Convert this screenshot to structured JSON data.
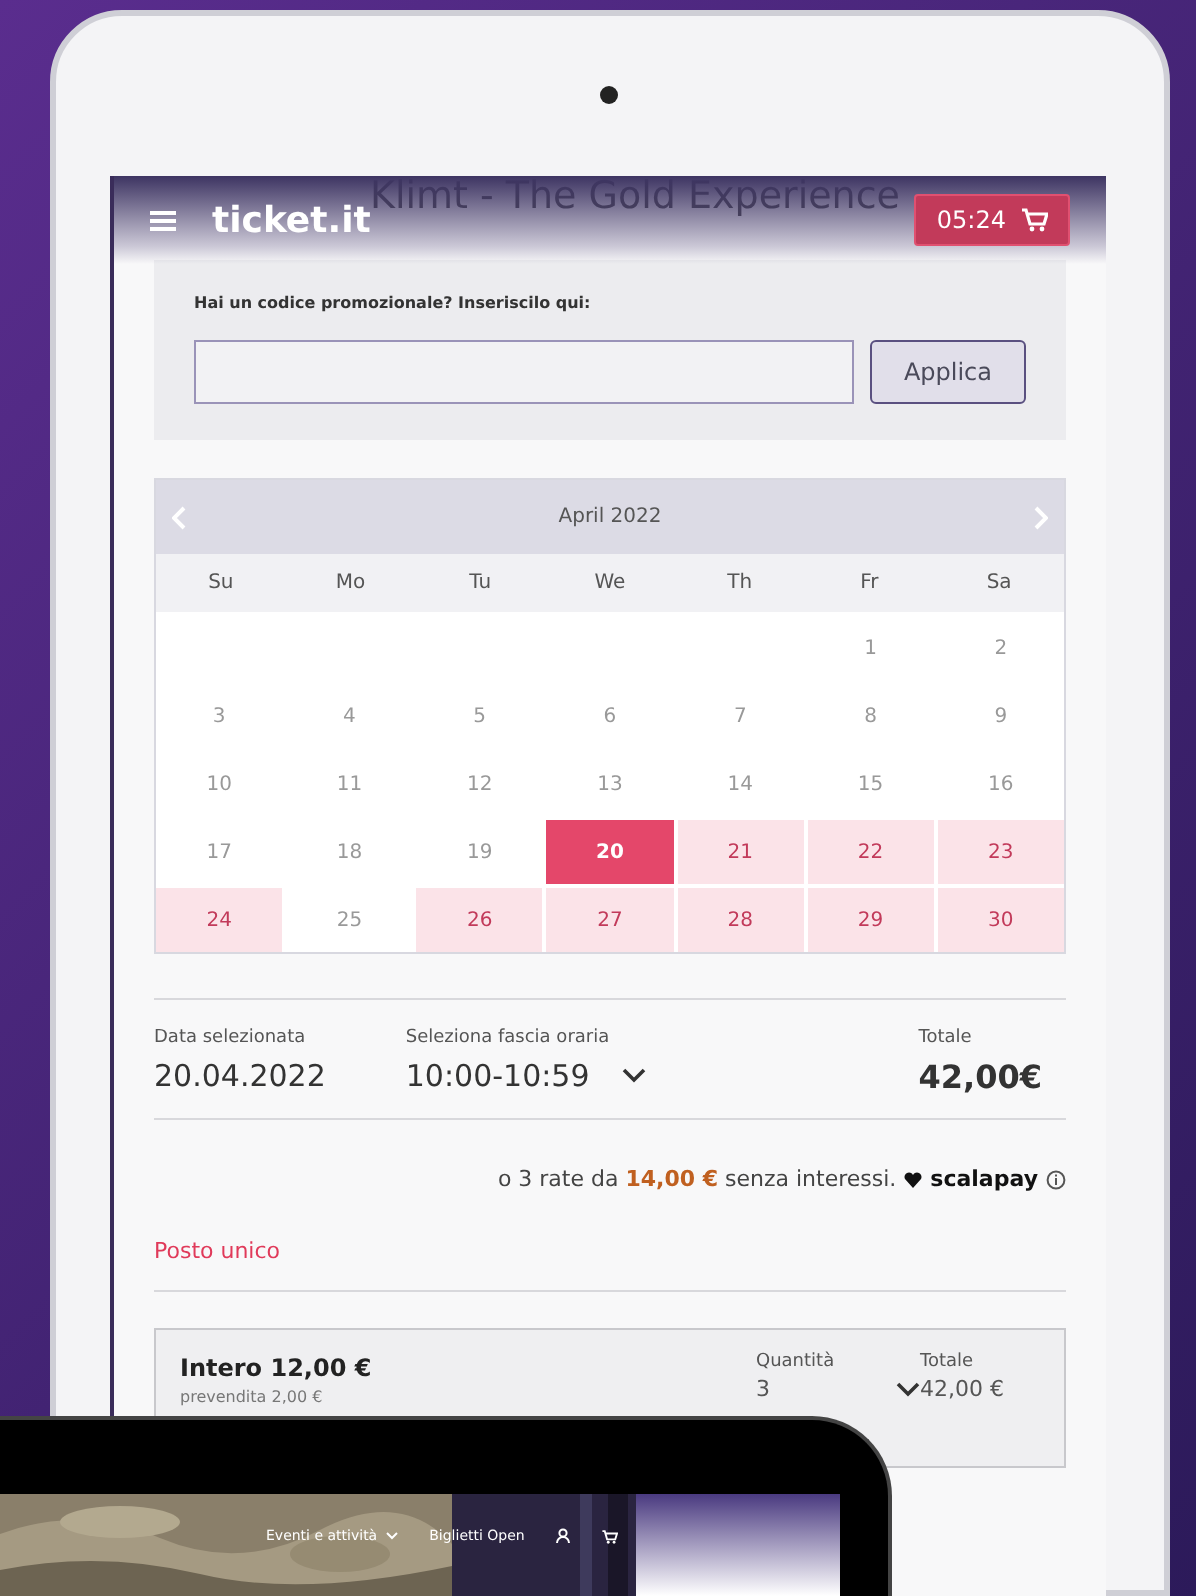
{
  "title": "Klimt - The Gold Experience",
  "header": {
    "logo": "ticket.it",
    "timer": "05:24"
  },
  "promo": {
    "label": "Hai un codice promozionale? Inseriscilo qui:",
    "button": "Applica"
  },
  "calendar": {
    "month": "April 2022",
    "weekdays": [
      "Su",
      "Mo",
      "Tu",
      "We",
      "Th",
      "Fr",
      "Sa"
    ],
    "weeks": [
      [
        {
          "kind": "blank"
        },
        {
          "kind": "blank"
        },
        {
          "kind": "blank"
        },
        {
          "kind": "blank"
        },
        {
          "kind": "blank"
        },
        {
          "kind": "day",
          "day": "1",
          "available": false,
          "selected": false
        },
        {
          "kind": "day",
          "day": "2",
          "available": false,
          "selected": false
        }
      ],
      [
        {
          "kind": "day",
          "day": "3",
          "available": false,
          "selected": false
        },
        {
          "kind": "day",
          "day": "4",
          "available": false,
          "selected": false
        },
        {
          "kind": "day",
          "day": "5",
          "available": false,
          "selected": false
        },
        {
          "kind": "day",
          "day": "6",
          "available": false,
          "selected": false
        },
        {
          "kind": "day",
          "day": "7",
          "available": false,
          "selected": false
        },
        {
          "kind": "day",
          "day": "8",
          "available": false,
          "selected": false
        },
        {
          "kind": "day",
          "day": "9",
          "available": false,
          "selected": false
        }
      ],
      [
        {
          "kind": "day",
          "day": "10",
          "available": false,
          "selected": false
        },
        {
          "kind": "day",
          "day": "11",
          "available": false,
          "selected": false
        },
        {
          "kind": "day",
          "day": "12",
          "available": false,
          "selected": false
        },
        {
          "kind": "day",
          "day": "13",
          "available": false,
          "selected": false
        },
        {
          "kind": "day",
          "day": "14",
          "available": false,
          "selected": false
        },
        {
          "kind": "day",
          "day": "15",
          "available": false,
          "selected": false
        },
        {
          "kind": "day",
          "day": "16",
          "available": false,
          "selected": false
        }
      ],
      [
        {
          "kind": "day",
          "day": "17",
          "available": false,
          "selected": false
        },
        {
          "kind": "day",
          "day": "18",
          "available": false,
          "selected": false
        },
        {
          "kind": "day",
          "day": "19",
          "available": false,
          "selected": false
        },
        {
          "kind": "day",
          "day": "20",
          "available": true,
          "selected": true
        },
        {
          "kind": "day",
          "day": "21",
          "available": true,
          "selected": false
        },
        {
          "kind": "day",
          "day": "22",
          "available": true,
          "selected": false
        },
        {
          "kind": "day",
          "day": "23",
          "available": true,
          "selected": false
        }
      ],
      [
        {
          "kind": "day",
          "day": "24",
          "available": true,
          "selected": false
        },
        {
          "kind": "day",
          "day": "25",
          "available": false,
          "selected": false
        },
        {
          "kind": "day",
          "day": "26",
          "available": true,
          "selected": false
        },
        {
          "kind": "day",
          "day": "27",
          "available": true,
          "selected": false
        },
        {
          "kind": "day",
          "day": "28",
          "available": true,
          "selected": false
        },
        {
          "kind": "day",
          "day": "29",
          "available": true,
          "selected": false
        },
        {
          "kind": "day",
          "day": "30",
          "available": true,
          "selected": false
        }
      ]
    ]
  },
  "selection": {
    "date_label": "Data selezionata",
    "date": "20.04.2022",
    "slot_label": "Seleziona fascia oraria",
    "slot": "10:00-10:59",
    "total_label": "Totale",
    "total": "42,00€"
  },
  "installments": {
    "text": "o 3 rate da **14,00 €** senza interessi.",
    "brand": "scalapay"
  },
  "section": "Posto unico",
  "ticket": {
    "name": "Intero 12,00 €",
    "fee": "prevendita 2,00 €",
    "qty_label": "Quantità",
    "qty": "3",
    "total_label": "Totale",
    "total": "42,00 €"
  },
  "second_device": {
    "nav": [
      {
        "label": "Eventi e attività",
        "dropdown": true
      },
      {
        "label": "Biglietti Open",
        "dropdown": false
      }
    ]
  }
}
